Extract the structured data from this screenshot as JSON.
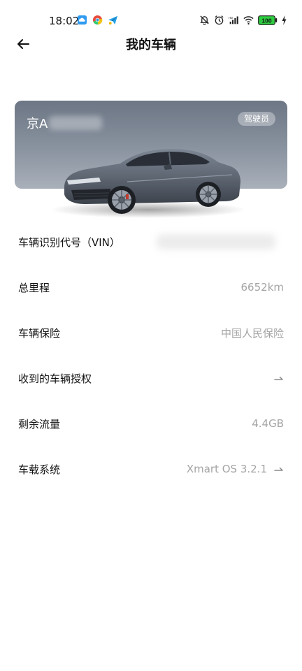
{
  "status_bar": {
    "time": "18:02",
    "battery_level": "100"
  },
  "header": {
    "title": "我的车辆"
  },
  "vehicle": {
    "plate_prefix": "京A",
    "role_badge": "驾驶员"
  },
  "info_rows": [
    {
      "label": "车辆识别代号（VIN）",
      "value": ""
    },
    {
      "label": "总里程",
      "value": "6652km"
    },
    {
      "label": "车辆保险",
      "value": "中国人民保险"
    },
    {
      "label": "收到的车辆授权",
      "value": ""
    },
    {
      "label": "剩余流量",
      "value": "4.4GB"
    },
    {
      "label": "车载系统",
      "value": "Xmart OS 3.2.1"
    }
  ],
  "icons": {
    "back": "back-arrow-icon",
    "row_arrow": "arrow-right-icon"
  },
  "colors": {
    "card_top": "#6c7684",
    "card_bottom": "#a9b0ba",
    "value_text": "#a4a4a4",
    "car_body": "#5f6773"
  }
}
